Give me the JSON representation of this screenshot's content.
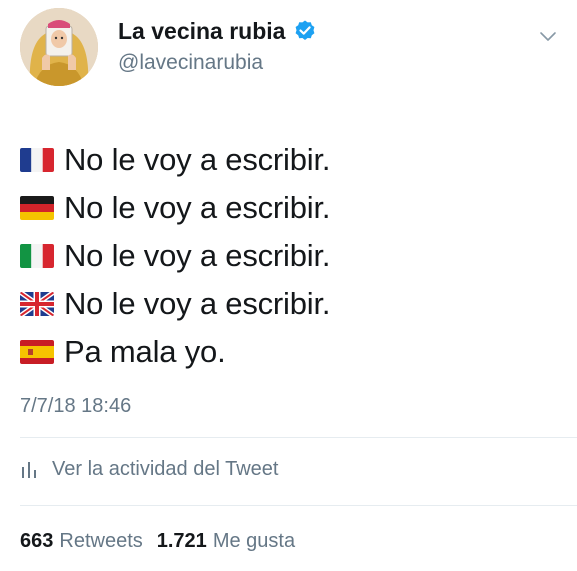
{
  "colors": {
    "text_primary": "#14171a",
    "text_secondary": "#657786",
    "verified_blue": "#1da1f2",
    "divider": "#e6ecf0"
  },
  "author": {
    "display_name": "La vecina rubia",
    "handle": "@lavecinarubia",
    "verified": true,
    "avatar_icon": "avatar"
  },
  "tweet": {
    "lines": [
      {
        "flag": "france-flag-icon",
        "text": "No le voy a escribir."
      },
      {
        "flag": "germany-flag-icon",
        "text": "No le voy a escribir."
      },
      {
        "flag": "italy-flag-icon",
        "text": "No le voy a escribir."
      },
      {
        "flag": "uk-flag-icon",
        "text": "No le voy a escribir."
      },
      {
        "flag": "spain-flag-icon",
        "text": "Pa mala yo."
      }
    ],
    "timestamp": "7/7/18 18:46"
  },
  "activity": {
    "icon": "bar-chart-icon",
    "label": "Ver la actividad del Tweet"
  },
  "stats": {
    "retweets_count": "663",
    "retweets_label": "Retweets",
    "likes_count": "1.721",
    "likes_label": "Me gusta"
  }
}
